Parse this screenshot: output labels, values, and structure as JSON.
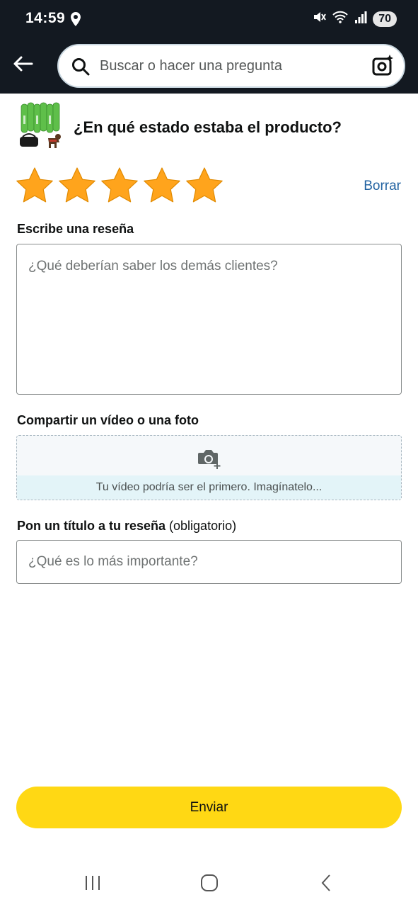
{
  "status_bar": {
    "time": "14:59",
    "battery": "70"
  },
  "search": {
    "placeholder": "Buscar o hacer una pregunta"
  },
  "review": {
    "question": "¿En qué estado estaba el producto?",
    "rating": 5,
    "max_rating": 5,
    "clear_label": "Borrar",
    "write_review_label": "Escribe una reseña",
    "review_placeholder": "¿Qué deberían saber los demás clientes?",
    "share_media_label": "Compartir un vídeo o una foto",
    "media_prompt": "Tu vídeo podría ser el primero. Imagínatelo...",
    "title_label": "Pon un título a tu reseña",
    "title_required": "(obligatorio)",
    "title_placeholder": "¿Qué es lo más importante?",
    "submit_label": "Enviar"
  },
  "colors": {
    "header_bg": "#131921",
    "star": "#ffa41c",
    "link": "#2162a1",
    "submit_bg": "#ffd814",
    "media_strip_bg": "#e3f4f8"
  },
  "icons": {
    "status_bar": [
      "location-pin-icon",
      "mute-icon",
      "wifi-icon",
      "signal-icon"
    ],
    "header": [
      "back-arrow-icon",
      "search-icon",
      "camera-lens-icon"
    ],
    "media": "camera-add-icon",
    "navigation": [
      "recent-apps-icon",
      "home-icon",
      "back-icon"
    ]
  }
}
